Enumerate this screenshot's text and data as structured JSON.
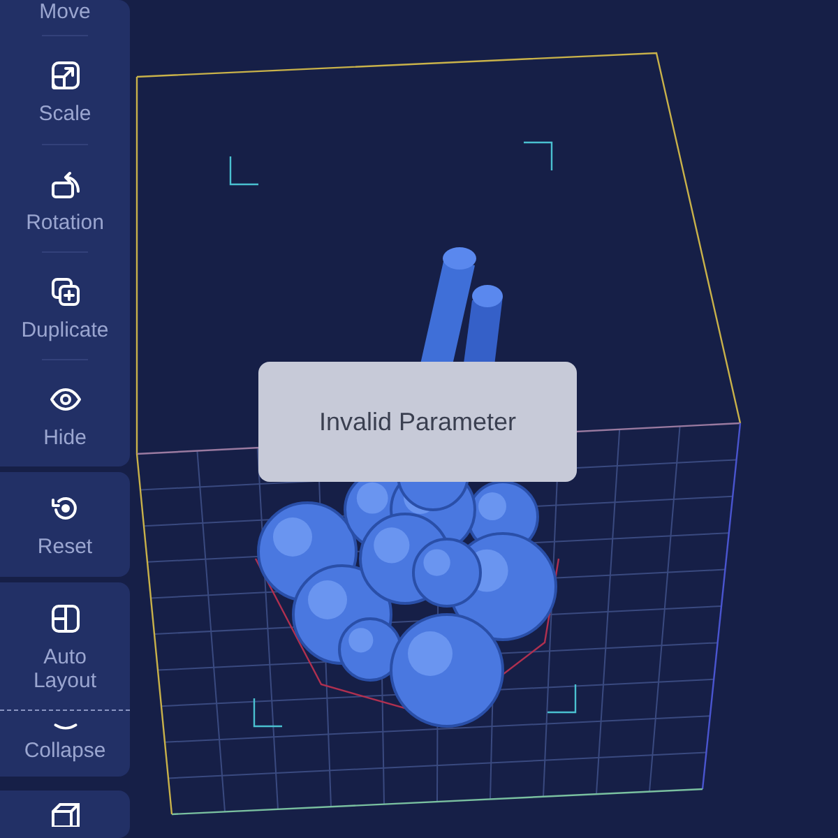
{
  "sidebar": {
    "groups": [
      {
        "items": [
          {
            "label": "Move"
          },
          {
            "label": "Scale"
          },
          {
            "label": "Rotation"
          },
          {
            "label": "Duplicate"
          },
          {
            "label": "Hide"
          }
        ]
      },
      {
        "items": [
          {
            "label": "Reset"
          }
        ]
      },
      {
        "items": [
          {
            "label": "Auto Layout"
          },
          {
            "label": "Collapse"
          }
        ]
      }
    ]
  },
  "toast": {
    "message": "Invalid Parameter"
  }
}
